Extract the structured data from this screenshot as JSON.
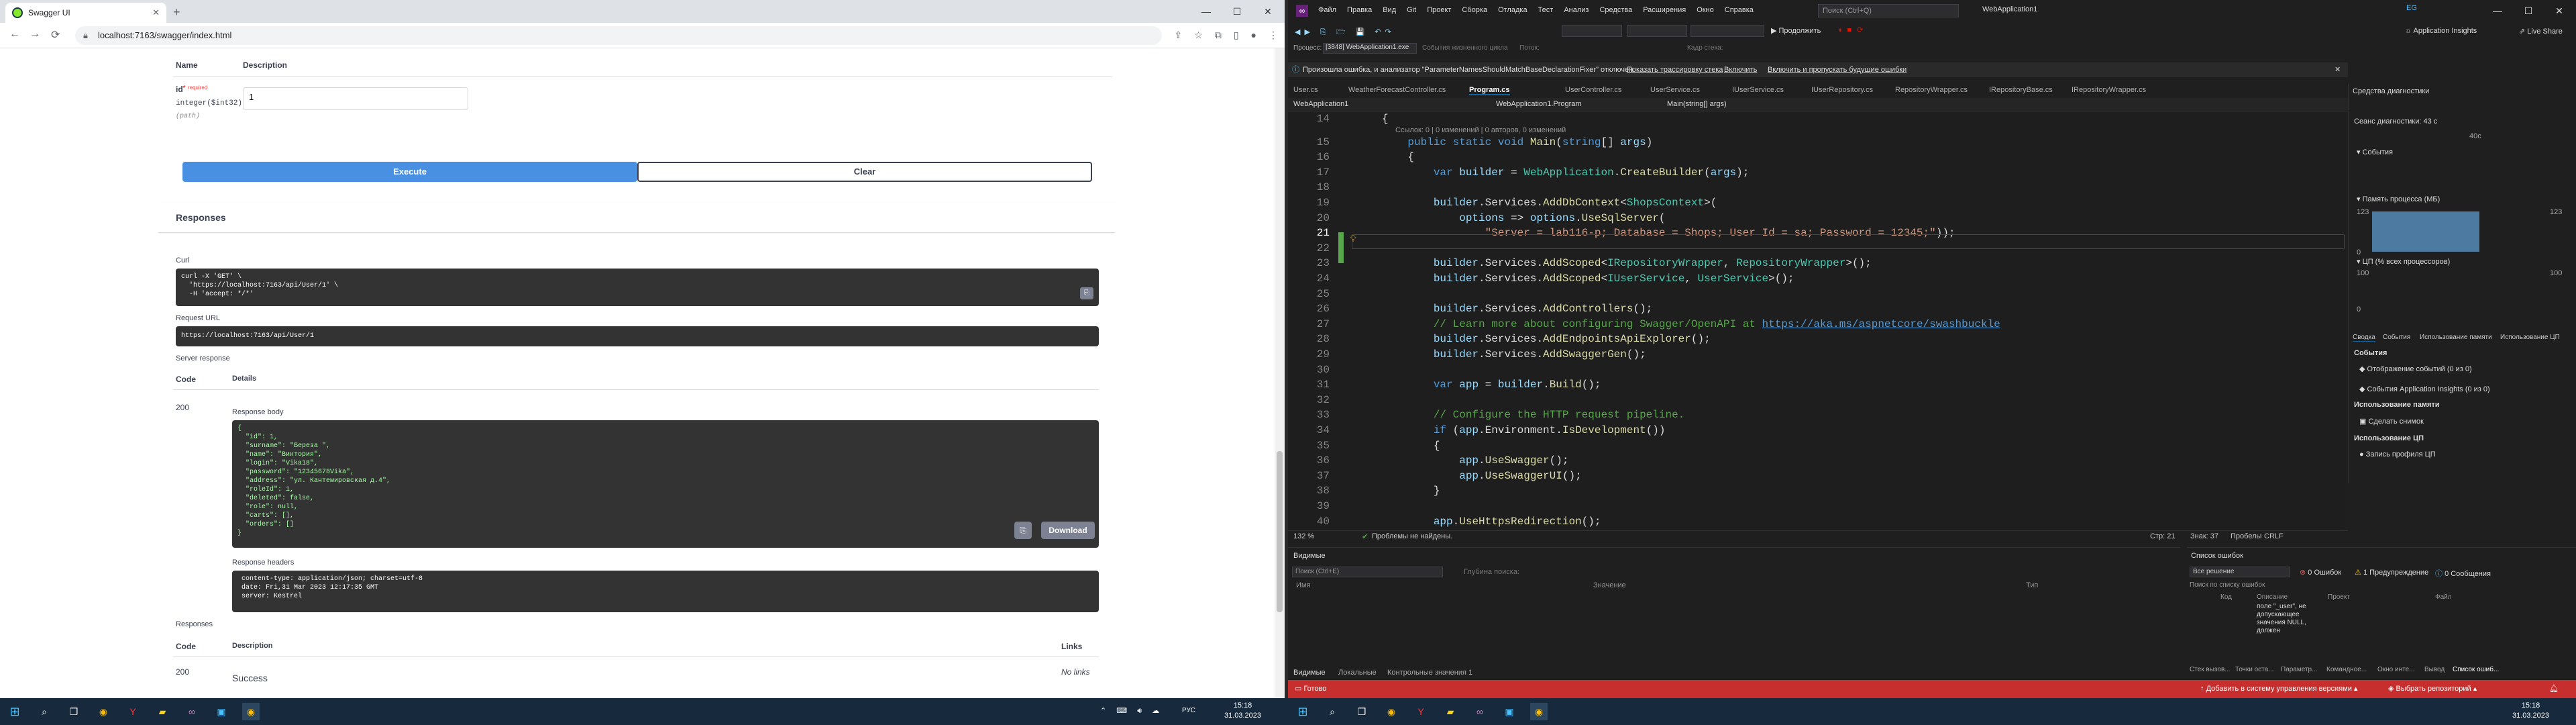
{
  "browser": {
    "tab_title": "Swagger UI",
    "url": "localhost:7163/swagger/index.html"
  },
  "swagger": {
    "param_headers": [
      "Name",
      "Description"
    ],
    "param_name": "id",
    "param_required_mark": "*",
    "param_required": "required",
    "param_type": "integer($int32)",
    "param_in": "(path)",
    "param_value": "1",
    "execute_label": "Execute",
    "clear_label": "Clear",
    "responses_title": "Responses",
    "curl_label": "Curl",
    "curl_text": "curl -X 'GET' \\\n  'https://localhost:7163/api/User/1' \\\n  -H 'accept: */*'",
    "request_url_label": "Request URL",
    "request_url": "https://localhost:7163/api/User/1",
    "server_response_label": "Server response",
    "col_code": "Code",
    "col_details": "Details",
    "code": "200",
    "response_body_label": "Response body",
    "response_body": "{\n  \"id\": 1,\n  \"surname\": \"Береза \",\n  \"name\": \"Виктория\",\n  \"login\": \"Vika18\",\n  \"password\": \"12345678Vika\",\n  \"address\": \"ул. Кантемировская д.4\",\n  \"roleId\": 1,\n  \"deleted\": false,\n  \"role\": null,\n  \"carts\": [],\n  \"orders\": []\n}",
    "download_label": "Download",
    "response_headers_label": "Response headers",
    "response_headers": " content-type: application/json; charset=utf-8 \n date: Fri,31 Mar 2023 12:17:35 GMT \n server: Kestrel ",
    "responses2_title": "Responses",
    "col_description": "Description",
    "col_links": "Links",
    "code2": "200",
    "success": "Success",
    "no_links": "No links"
  },
  "vs": {
    "menu": [
      "Файл",
      "Правка",
      "Вид",
      "Git",
      "Проект",
      "Сборка",
      "Отладка",
      "Тест",
      "Анализ",
      "Средства",
      "Расширения",
      "Окно",
      "Справка"
    ],
    "search_placeholder": "Поиск (Ctrl+Q)",
    "solution_name": "WebApplication1",
    "user_badge": "EG",
    "live_share": "Live Share",
    "process_label": "Процесс:",
    "process_value": "[3848] WebApplication1.exe",
    "events_label": "События жизненного цикла",
    "thread_label": "Поток:",
    "stack_label": "Кадр стека:",
    "continue_label": "Продолжить",
    "app_insights": "Application Insights",
    "infobar_text": "Произошла ошибка, и анализатор \"ParameterNamesShouldMatchBaseDeclarationFixer\" отключен.",
    "infobar_link1": "Показать трассировку стека",
    "infobar_link2": "Включить",
    "infobar_link3": "Включить и пропускать будущие ошибки",
    "doc_tabs": [
      "User.cs",
      "WeatherForecastController.cs",
      "Program.cs",
      "UserController.cs",
      "UserService.cs",
      "IUserService.cs",
      "IUserRepository.cs",
      "RepositoryWrapper.cs",
      "IRepositoryBase.cs",
      "IRepositoryWrapper.cs"
    ],
    "nav_project": "WebApplication1",
    "nav_class": "WebApplication1.Program",
    "nav_member": "Main(string[] args)",
    "codelens": "Ссылок: 0 | 0 изменений | 0 авторов, 0 изменений",
    "line_numbers": [
      "14",
      "15",
      "16",
      "17",
      "18",
      "19",
      "20",
      "21",
      "22",
      "23",
      "24",
      "25",
      "26",
      "27",
      "28",
      "29",
      "30",
      "31",
      "32",
      "33",
      "34",
      "35",
      "36",
      "37",
      "38",
      "39",
      "40"
    ],
    "zoom": "132 %",
    "no_problems": "Проблемы не найдены.",
    "line_col": "Стр: 21",
    "char_col": "Знак: 37",
    "spaces": "Пробелы",
    "crlf": "CRLF",
    "diag_title": "Средства диагностики",
    "diag_session": "Сеанс диагностики: 43 с",
    "diag_time_tick": "40с",
    "diag_events": "События",
    "diag_memory": "Память процесса (МБ)",
    "diag_mem_max": "123",
    "diag_mem_min": "0",
    "diag_cpu": "ЦП (% всех процессоров)",
    "diag_cpu_max": "100",
    "diag_cpu_min": "0",
    "diag_tabs": [
      "Сводка",
      "События",
      "Использование памяти",
      "Использование ЦП"
    ],
    "diag_events_header": "События",
    "diag_event1": "Отображение событий (0 из 0)",
    "diag_event2": "События Application Insights (0 из 0)",
    "diag_mem_header": "Использование памяти",
    "diag_snapshot": "Сделать снимок",
    "diag_cpu_header": "Использование ЦП",
    "diag_profile": "Запись профиля ЦП",
    "output_title": "Видимые",
    "output_search": "Поиск (Ctrl+E)",
    "output_depth": "Глубина поиска:",
    "output_cols": [
      "Имя",
      "Значение",
      "Тип"
    ],
    "output_tabs": [
      "Видимые",
      "Локальные",
      "Контрольные значения 1"
    ],
    "err_title": "Список ошибок",
    "err_scope": "Все решение",
    "err_errors": "0 Ошибок",
    "err_warnings": "1 Предупреждение",
    "err_messages": "0 Сообщения",
    "err_search": "Поиск по списку ошибок",
    "err_cols": [
      "Код",
      "Описание",
      "Проект",
      "Файл"
    ],
    "err_desc": "поле \"_user\", не допускающее значения NULL, должен",
    "err_tabs": [
      "Стек вызов...",
      "Точки оста...",
      "Параметр...",
      "Командное...",
      "Окно инте...",
      "Вывод",
      "Список ошиб..."
    ],
    "status_ready": "Готово",
    "status_add_vcs": "Добавить в систему управления версиями",
    "status_repo": "Выбрать репозиторий"
  },
  "taskbar": {
    "time": "15:18",
    "date": "31.03.2023",
    "lang": "РУС"
  }
}
